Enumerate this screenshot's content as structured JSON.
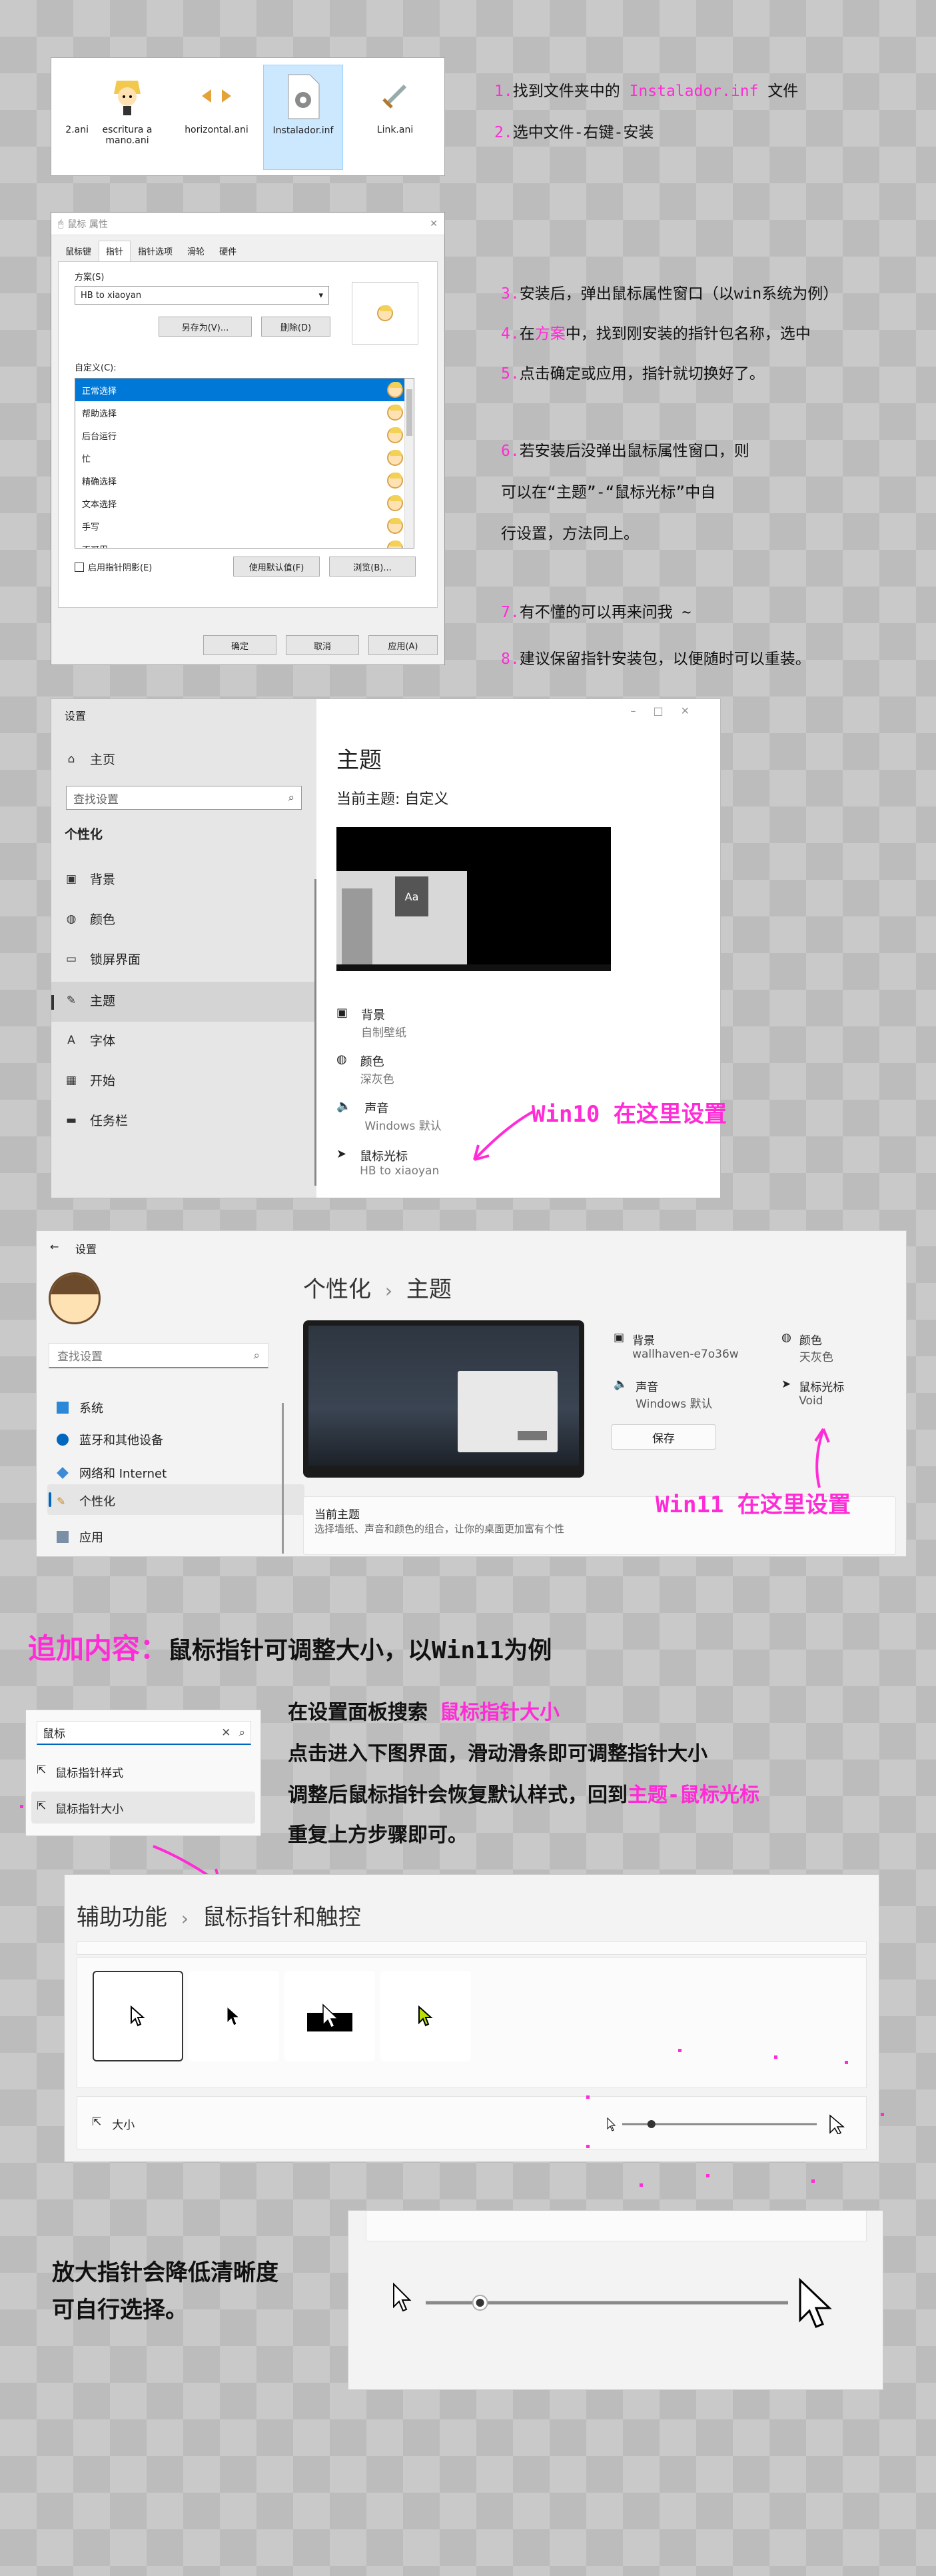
{
  "files": [
    {
      "name": "2.ani"
    },
    {
      "name": "escritura a mano.ani"
    },
    {
      "name": "horizontal.ani"
    },
    {
      "name": "Instalador.inf"
    },
    {
      "name": "Link.ani"
    }
  ],
  "notes": {
    "n1_num": "1.",
    "n1_a": "找到文件夹中的 ",
    "n1_hl": "Instalador.inf",
    "n1_b": " 文件",
    "n2_num": "2.",
    "n2": "选中文件-右键-安装",
    "n3_num": "3.",
    "n3": "安装后，弹出鼠标属性窗口（以win系统为例）",
    "n4_num": "4.",
    "n4_a": "在",
    "n4_hl": "方案",
    "n4_b": "中，找到刚安装的指针包名称，选中",
    "n5_num": "5.",
    "n5": "点击确定或应用，指针就切换好了。",
    "n6_num": "6.",
    "n6_l1": "若安装后没弹出鼠标属性窗口，则",
    "n6_l2": "可以在“主题”-“鼠标光标”中自",
    "n6_l3": "行设置，方法同上。",
    "n7_num": "7.",
    "n7": "有不懂的可以再来问我 ~",
    "n8_num": "8.",
    "n8": "建议保留指针安装包，以便随时可以重装。",
    "win10_label": "Win10 在这里设置",
    "win11_label": "Win11 在这里设置",
    "add_title": "追加内容：",
    "add_rest": "鼠标指针可调整大小，以Win11为例",
    "s1_a": "在设置面板搜索 ",
    "s1_hl": "鼠标指针大小",
    "s2": "点击进入下图界面，滑动滑条即可调整指针大小",
    "s3_a": "调整后鼠标指针会恢复默认样式，回到",
    "s3_hl": "主题-鼠标光标",
    "s4": "重复上方步骤即可。",
    "zoom_l1": "放大指针会降低清晰度",
    "zoom_l2": "可自行选择。"
  },
  "dialog": {
    "title": "鼠标 属性",
    "tabs": [
      "鼠标键",
      "指针",
      "指针选项",
      "滑轮",
      "硬件"
    ],
    "scheme_label": "方案(S)",
    "scheme_value": "HB to xiaoyan",
    "save_as": "另存为(V)...",
    "delete": "删除(D)",
    "custom_label": "自定义(C):",
    "rows": [
      "正常选择",
      "帮助选择",
      "后台运行",
      "忙",
      "精确选择",
      "文本选择",
      "手写",
      "不可用"
    ],
    "shadow": "启用指针阴影(E)",
    "use_default": "使用默认值(F)",
    "browse": "浏览(B)...",
    "ok": "确定",
    "cancel": "取消",
    "apply": "应用(A)"
  },
  "w10": {
    "title": "设置",
    "home": "主页",
    "search_placeholder": "查找设置",
    "section": "个性化",
    "nav": [
      "背景",
      "颜色",
      "锁屏界面",
      "主题",
      "字体",
      "开始",
      "任务栏"
    ],
    "heading": "主题",
    "current": "当前主题: 自定义",
    "preview_tile": "Aa",
    "opts": [
      {
        "label": "背景",
        "sub": "自制壁纸"
      },
      {
        "label": "颜色",
        "sub": "深灰色"
      },
      {
        "label": "声音",
        "sub": "Windows 默认"
      },
      {
        "label": "鼠标光标",
        "sub": "HB to xiaoyan"
      }
    ]
  },
  "w11": {
    "title": "设置",
    "search_placeholder": "查找设置",
    "nav": [
      "系统",
      "蓝牙和其他设备",
      "网络和 Internet",
      "个性化",
      "应用"
    ],
    "crumb1": "个性化",
    "crumb2": "主题",
    "cards": [
      {
        "label": "背景",
        "sub": "wallhaven-e7o36w"
      },
      {
        "label": "颜色",
        "sub": "天灰色"
      },
      {
        "label": "声音",
        "sub": "Windows 默认"
      },
      {
        "label": "鼠标光标",
        "sub": "Void"
      }
    ],
    "save": "保存",
    "current_title": "当前主题",
    "current_desc": "选择墙纸、声音和颜色的组合，让你的桌面更加富有个性"
  },
  "search": {
    "query": "鼠标",
    "results": [
      "鼠标指针样式",
      "鼠标指针大小"
    ]
  },
  "access": {
    "crumb1": "辅助功能",
    "crumb2": "鼠标指针和触控",
    "size_label": "大小",
    "size_level": 0.15
  },
  "colors": {
    "highlight": "#ff2bd6",
    "selection": "#0078d7"
  }
}
